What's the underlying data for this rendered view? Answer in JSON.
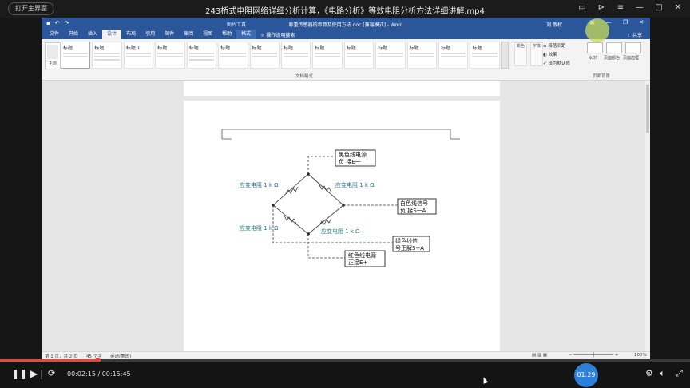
{
  "player": {
    "back_label": "打开主界面",
    "video_title": "243桥式电阻网络详细分析计算，《电路分析》等效电阻分析方法详细讲解.mp4",
    "current_time": "00:02:15",
    "separator": " / ",
    "total_time": "00:15:45",
    "timer_badge": "01:29",
    "progress_fraction": 0.143
  },
  "word": {
    "doc_title": "称重传感器的参数及使用方法.doc [兼容模式] - Word",
    "picture_tools": "图片工具",
    "user": "刘 敬权",
    "tabs": [
      "文件",
      "开始",
      "插入",
      "设计",
      "布局",
      "引用",
      "邮件",
      "审阅",
      "视图",
      "帮助",
      "格式"
    ],
    "active_tab": "设计",
    "tell_me": "操作说明搜索",
    "share": "共享",
    "theme_label": "主题",
    "styles": [
      "标题",
      "标题",
      "标题 1",
      "标题",
      "标题",
      "标题",
      "标题",
      "标题",
      "标题",
      "标题",
      "标题",
      "标题",
      "标题",
      "标题"
    ],
    "colors_label": "颜色",
    "fonts_label": "字体",
    "paragraph_spacing": "段落间距",
    "effects": "效果",
    "set_default": "设为默认值",
    "watermark": "水印",
    "page_color": "页面颜色",
    "page_border": "页面边框",
    "group_doc_format": "文档格式",
    "group_page_bg": "页面背景"
  },
  "diagram": {
    "label_black": [
      "黑色线电源",
      "负 接E一"
    ],
    "label_white": [
      "白色线信号",
      "负 接S一A"
    ],
    "label_green": [
      "绿色线信",
      "号正解S+A"
    ],
    "label_red": [
      "红色线电源",
      "正接E+"
    ],
    "r_top_left": "应变电阻 1 k Ω",
    "r_top_right": "应变电阻 1 k Ω",
    "r_bottom_left": "应变电阻 1 k Ω",
    "r_bottom_right": "应变电阻 1 k Ω"
  },
  "status": {
    "page": "第 1 页，共 2 页",
    "words": "45 个字",
    "lang": "英语(美国)",
    "zoom": "100%"
  }
}
